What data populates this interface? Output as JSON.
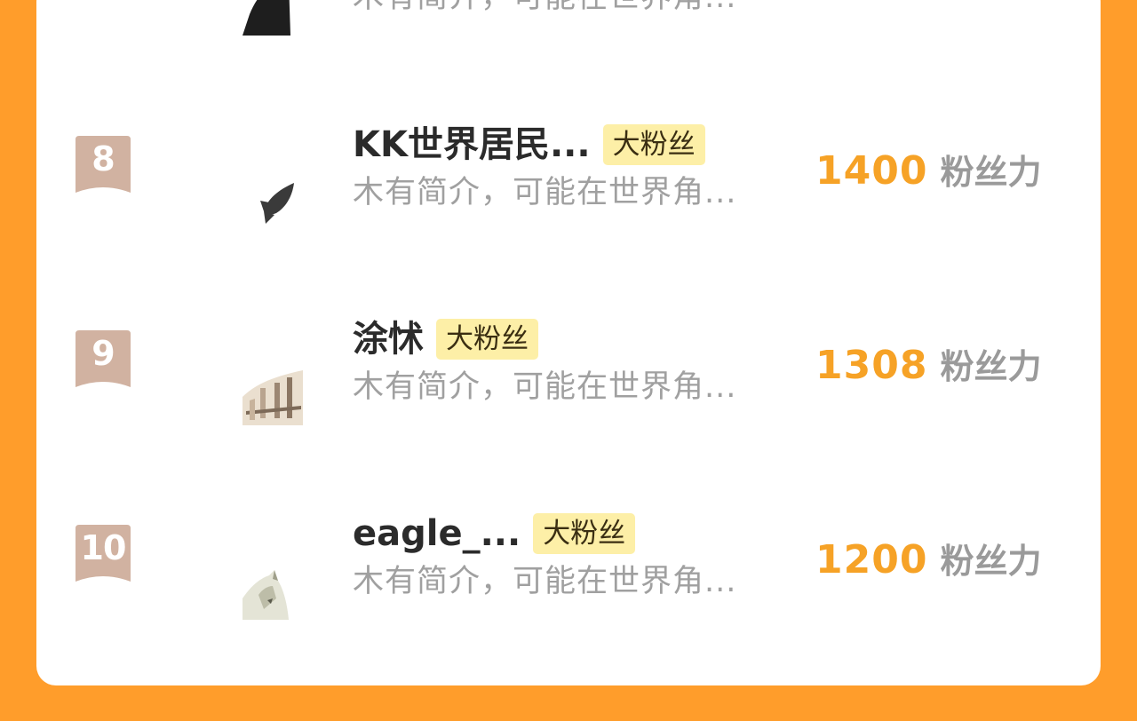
{
  "rows": [
    {
      "rank": "",
      "name": "",
      "badge": "",
      "description": "木有简介，可能在世界角...",
      "score": "",
      "unit": "",
      "avatar_icon": "dark-figure-icon"
    },
    {
      "rank": "8",
      "name": "KK世界居民...",
      "badge": "大粉丝",
      "description": "木有简介，可能在世界角...",
      "score": "1400",
      "unit": "粉丝力",
      "avatar_icon": "fish-icon"
    },
    {
      "rank": "9",
      "name": "涂怵",
      "badge": "大粉丝",
      "description": "木有简介，可能在世界角...",
      "score": "1308",
      "unit": "粉丝力",
      "avatar_icon": "building-sketch-icon"
    },
    {
      "rank": "10",
      "name": "eagle_...",
      "badge": "大粉丝",
      "description": "木有简介，可能在世界角...",
      "score": "1200",
      "unit": "粉丝力",
      "avatar_icon": "fox-sketch-icon"
    }
  ],
  "colors": {
    "background": "#ff9d2b",
    "card": "#ffffff",
    "score": "#f6a226",
    "badge_bg": "#fdefa7",
    "rank_ribbon": "#d1b2a1"
  }
}
